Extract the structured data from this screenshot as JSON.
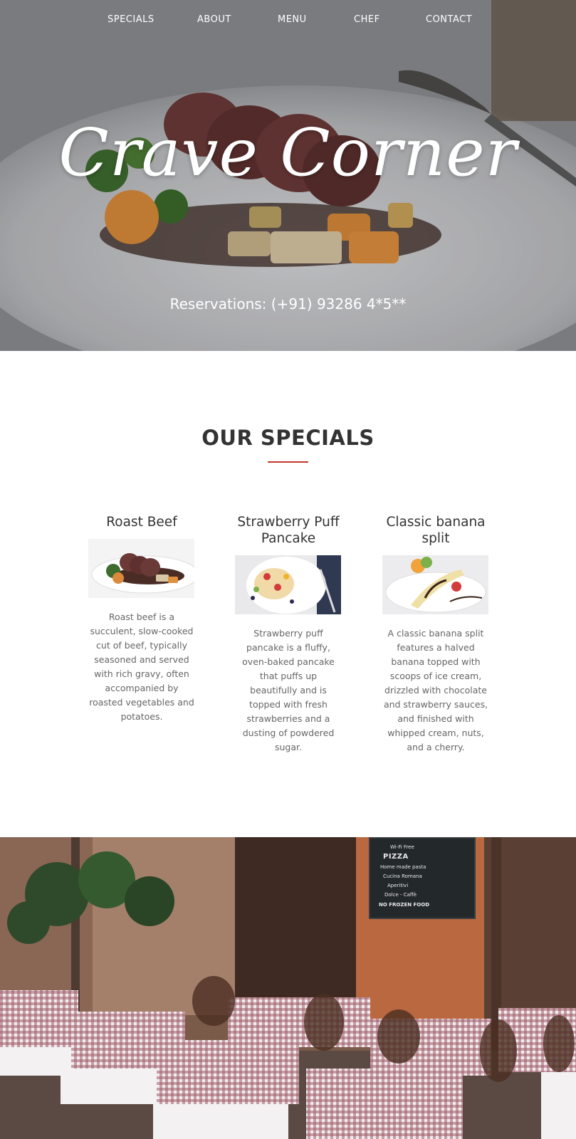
{
  "nav": {
    "items": [
      "SPECIALS",
      "ABOUT",
      "MENU",
      "CHEF",
      "CONTACT"
    ]
  },
  "hero": {
    "title": "Crave Corner",
    "reservations": "Reservations: (+91) 93286 4*5**"
  },
  "specials": {
    "heading": "OUR SPECIALS",
    "items": [
      {
        "title": "Roast Beef",
        "description": "Roast beef is a succulent, slow-cooked cut of beef, typically seasoned and served with rich gravy, often accompanied by roasted vegetables and potatoes."
      },
      {
        "title": "Strawberry Puff Pancake",
        "description": "Strawberry puff pancake is a fluffy, oven-baked pancake that puffs up beautifully and is topped with fresh strawberries and a dusting of powdered sugar."
      },
      {
        "title": "Classic banana split",
        "description": "A classic banana split features a halved banana topped with scoops of ice cream, drizzled with chocolate and strawberry sauces, and finished with whipped cream, nuts, and a cherry."
      }
    ]
  },
  "cafe_board": {
    "lines": [
      "Wi-Fi Free",
      "PIZZA",
      "Home made pasta",
      "Cucina Romana",
      "Aperitivi",
      "Dolce - Caffè",
      "NO FROZEN FOOD"
    ]
  },
  "colors": {
    "accent": "#c0392b",
    "heading": "#333333",
    "body_text": "#666666"
  }
}
